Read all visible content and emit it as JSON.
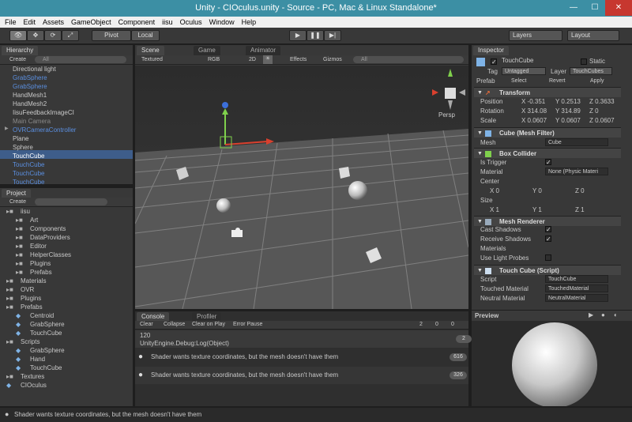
{
  "window": {
    "title": "Unity - CIOculus.unity - Source - PC, Mac & Linux Standalone*"
  },
  "menu": [
    "File",
    "Edit",
    "Assets",
    "GameObject",
    "Component",
    "iisu",
    "Oculus",
    "Window",
    "Help"
  ],
  "toolbar": {
    "pivot": "Pivot",
    "local": "Local",
    "layers": "Layers",
    "layout": "Layout"
  },
  "hierarchy": {
    "tab": "Hierarchy",
    "create": "Create",
    "search": "All",
    "items": [
      {
        "label": "Directional light",
        "color": "#c8c8c8"
      },
      {
        "label": "GrabSphere",
        "color": "#5b8fe0"
      },
      {
        "label": "GrabSphere",
        "color": "#5b8fe0"
      },
      {
        "label": "HandMesh1",
        "color": "#c8c8c8"
      },
      {
        "label": "HandMesh2",
        "color": "#c8c8c8"
      },
      {
        "label": "IisuFeedbackImageCI",
        "color": "#c8c8c8"
      },
      {
        "label": "Main Camera",
        "color": "#8a8a8a"
      },
      {
        "label": "OVRCameraController",
        "color": "#5b8fe0"
      },
      {
        "label": "Plane",
        "color": "#c8c8c8"
      },
      {
        "label": "Sphere",
        "color": "#c8c8c8"
      },
      {
        "label": "TouchCube",
        "color": "#ffffff"
      },
      {
        "label": "TouchCube",
        "color": "#5b8fe0"
      },
      {
        "label": "TouchCube",
        "color": "#5b8fe0"
      },
      {
        "label": "TouchCube",
        "color": "#5b8fe0"
      }
    ]
  },
  "project": {
    "tab": "Project",
    "create": "Create",
    "items": [
      {
        "label": "iisu"
      },
      {
        "label": "Art"
      },
      {
        "label": "Components"
      },
      {
        "label": "DataProviders"
      },
      {
        "label": "Editor"
      },
      {
        "label": "HelperClasses"
      },
      {
        "label": "Plugins"
      },
      {
        "label": "Prefabs"
      },
      {
        "label": "Materials"
      },
      {
        "label": "OVR"
      },
      {
        "label": "Plugins"
      },
      {
        "label": "Prefabs"
      },
      {
        "label": "Centroid"
      },
      {
        "label": "GrabSphere"
      },
      {
        "label": "TouchCube"
      },
      {
        "label": "Scripts"
      },
      {
        "label": "GrabSphere"
      },
      {
        "label": "Hand"
      },
      {
        "label": "TouchCube"
      },
      {
        "label": "Textures"
      },
      {
        "label": "CIOculus"
      }
    ]
  },
  "scene": {
    "tabs": [
      "Scene",
      "Game",
      "Animator"
    ],
    "textured": "Textured",
    "rgb": "RGB",
    "mode2d": "2D",
    "effects": "Effects",
    "gizmos": "Gizmos",
    "search": "All",
    "persp": "Persp"
  },
  "console": {
    "tabs": [
      "Console",
      "Profiler"
    ],
    "buttons": [
      "Clear",
      "Collapse",
      "Clear on Play",
      "Error Pause"
    ],
    "counts": {
      "info": "2",
      "warn": "0",
      "error": "0"
    },
    "entries": [
      {
        "line1": "120",
        "line2": "UnityEngine.Debug:Log(Object)",
        "count": "2"
      },
      {
        "line1": "Shader wants texture coordinates, but the mesh  doesn't have them",
        "line2": "",
        "count": "616"
      },
      {
        "line1": "Shader wants texture coordinates, but the mesh  doesn't have them",
        "line2": "",
        "count": "326"
      }
    ]
  },
  "status": {
    "message": "Shader wants texture coordinates, but the mesh  doesn't have them"
  },
  "inspector": {
    "tab": "Inspector",
    "name": "TouchCube",
    "static": "Static",
    "tag_label": "Tag",
    "tag": "Untagged",
    "layer_label": "Layer",
    "layer": "TouchCubes",
    "prefab_label": "Prefab",
    "select": "Select",
    "revert": "Revert",
    "apply": "Apply",
    "transform": {
      "title": "Transform",
      "position": "Position",
      "rotation": "Rotation",
      "scale": "Scale",
      "pos": [
        "X -0.351",
        "Y 0.2513",
        "Z 0.3633"
      ],
      "rot": [
        "X 314.08",
        "Y 314.89",
        "Z 0"
      ],
      "scl": [
        "X 0.0607",
        "Y 0.0607",
        "Z 0.0607"
      ]
    },
    "mesh_filter": {
      "title": "Cube (Mesh Filter)",
      "mesh_label": "Mesh",
      "mesh": "Cube"
    },
    "box_collider": {
      "title": "Box Collider",
      "is_trigger": "Is Trigger",
      "material_label": "Material",
      "material": "None (Physic Materi",
      "center": "Center",
      "cx": "X 0",
      "cy": "Y 0",
      "cz": "Z 0",
      "size": "Size",
      "sx": "X 1",
      "sy": "Y 1",
      "sz": "Z 1"
    },
    "mesh_renderer": {
      "title": "Mesh Renderer",
      "cast": "Cast Shadows",
      "receive": "Receive Shadows",
      "materials": "Materials",
      "light_probes": "Use Light Probes"
    },
    "script": {
      "title": "Touch Cube (Script)",
      "script_label": "Script",
      "script": "TouchCube",
      "touched_label": "Touched Material",
      "touched": "TouchedMaterial",
      "neutral_label": "Neutral Material",
      "neutral": "NeutralMaterial"
    },
    "preview": "Preview"
  }
}
